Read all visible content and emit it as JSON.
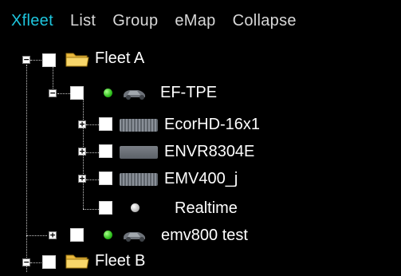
{
  "menu": {
    "items": [
      "Xfleet",
      "List",
      "Group",
      "eMap",
      "Collapse"
    ],
    "active_color": "#1ec6de"
  },
  "tree": {
    "fleet_a": {
      "label": "Fleet A",
      "expander": "−",
      "vehicles": {
        "ef_tpe": {
          "label": "EF-TPE",
          "expander": "−",
          "status": "online",
          "devices": [
            {
              "label": "EcorHD-16x1",
              "expander": "+"
            },
            {
              "label": "ENVR8304E",
              "expander": "+"
            },
            {
              "label": "EMV400_j",
              "expander": "+"
            }
          ],
          "realtime": {
            "label": "Realtime",
            "status": "offline"
          }
        },
        "emv800": {
          "label": "emv800 test",
          "expander": "+",
          "status": "online"
        }
      }
    },
    "fleet_b": {
      "label": "Fleet B",
      "expander": "−"
    }
  },
  "colors": {
    "background": "#000000",
    "menu_text": "#d8d8d8",
    "online": "#2ebd1c",
    "offline": "#bfbfbf"
  }
}
